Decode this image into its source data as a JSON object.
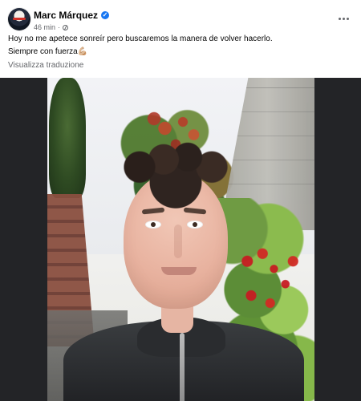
{
  "post": {
    "author": "Marc Márquez",
    "time": "46 min",
    "separator": "·",
    "caption_lines": [
      "Hoy no me apetece sonreír pero buscaremos la manera de volver hacerlo.",
      "Siempre con fuerza💪🏼"
    ],
    "translate_label": "Visualizza traduzione"
  },
  "icons": {
    "verified": "verified-badge-icon",
    "audience": "audience-icon",
    "more": "more-options-icon"
  },
  "colors": {
    "verified": "#1877f2",
    "meta_text": "#65676b"
  }
}
